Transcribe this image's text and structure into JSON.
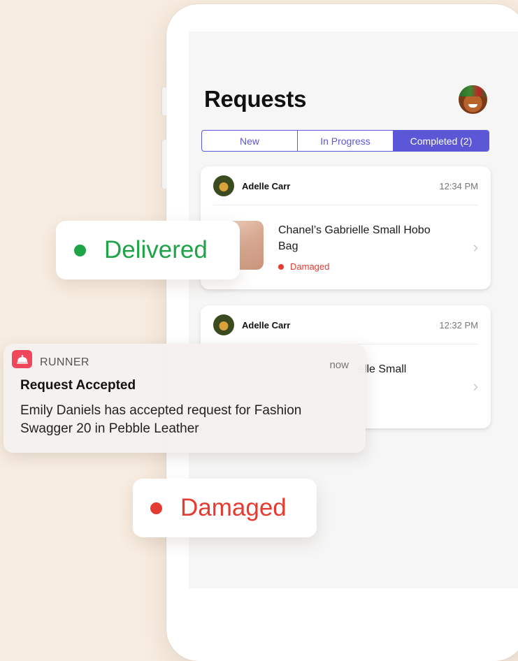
{
  "screen": {
    "title": "Requests"
  },
  "tabs": [
    {
      "label": "New",
      "active": false
    },
    {
      "label": "In Progress",
      "active": false
    },
    {
      "label": "Completed (2)",
      "active": true
    }
  ],
  "cards": [
    {
      "user": "Adelle Carr",
      "time": "12:34 PM",
      "product": "Chanel’s Gabrielle Small Hobo Bag",
      "status": "Damaged"
    },
    {
      "user": "Adelle Carr",
      "time": "12:32 PM",
      "product_partial": "elle Small"
    }
  ],
  "pills": {
    "delivered": "Delivered",
    "damaged": "Damaged"
  },
  "notification": {
    "app": "RUNNER",
    "time": "now",
    "title": "Request Accepted",
    "body": "Emily Daniels has accepted request for Fashion Swagger 20 in Pebble Leather"
  },
  "colors": {
    "accent": "#5b57d6",
    "delivered": "#1fa347",
    "damaged": "#e53b30",
    "background": "#f8ede1",
    "app_icon": "#f0485a"
  },
  "icons": {
    "app_icon": "bell-icon",
    "chevron": "chevron-right-icon"
  }
}
